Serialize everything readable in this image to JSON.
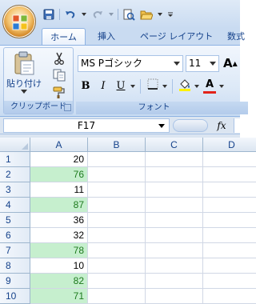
{
  "ribbon": {
    "tabs": [
      {
        "label": "ホーム",
        "active": true
      },
      {
        "label": "挿入",
        "active": false
      },
      {
        "label": "ページ レイアウト",
        "active": false
      },
      {
        "label": "数式",
        "active": false
      }
    ],
    "clipboard": {
      "paste_label": "貼り付け",
      "group_label": "クリップボード"
    },
    "font": {
      "font_name": "MS Pゴシック",
      "font_size": "11",
      "grow_label": "A",
      "bold_label": "B",
      "italic_label": "I",
      "underline_label": "U",
      "font_color_label": "A",
      "group_label": "フォント"
    }
  },
  "formula_bar": {
    "name_box": "F17",
    "fx_label": "fx",
    "formula": ""
  },
  "sheet": {
    "columns": [
      "A",
      "B",
      "C",
      "D"
    ],
    "rows": [
      {
        "num": "1",
        "a": "20",
        "highlight": false
      },
      {
        "num": "2",
        "a": "76",
        "highlight": true
      },
      {
        "num": "3",
        "a": "11",
        "highlight": false
      },
      {
        "num": "4",
        "a": "87",
        "highlight": true
      },
      {
        "num": "5",
        "a": "36",
        "highlight": false
      },
      {
        "num": "6",
        "a": "32",
        "highlight": false
      },
      {
        "num": "7",
        "a": "78",
        "highlight": true
      },
      {
        "num": "8",
        "a": "10",
        "highlight": false
      },
      {
        "num": "9",
        "a": "82",
        "highlight": true
      },
      {
        "num": "10",
        "a": "71",
        "highlight": true
      },
      {
        "num": "11",
        "a": "",
        "highlight": false
      }
    ],
    "highlight_fill": "#c6efce",
    "highlight_text": "#1e7b1e"
  },
  "colors": {
    "ribbon_blue": "#c9dbf1",
    "label_blue": "#15428b",
    "font_color_bar": "#e2231a",
    "highlight_color_bar": "#fff200"
  }
}
